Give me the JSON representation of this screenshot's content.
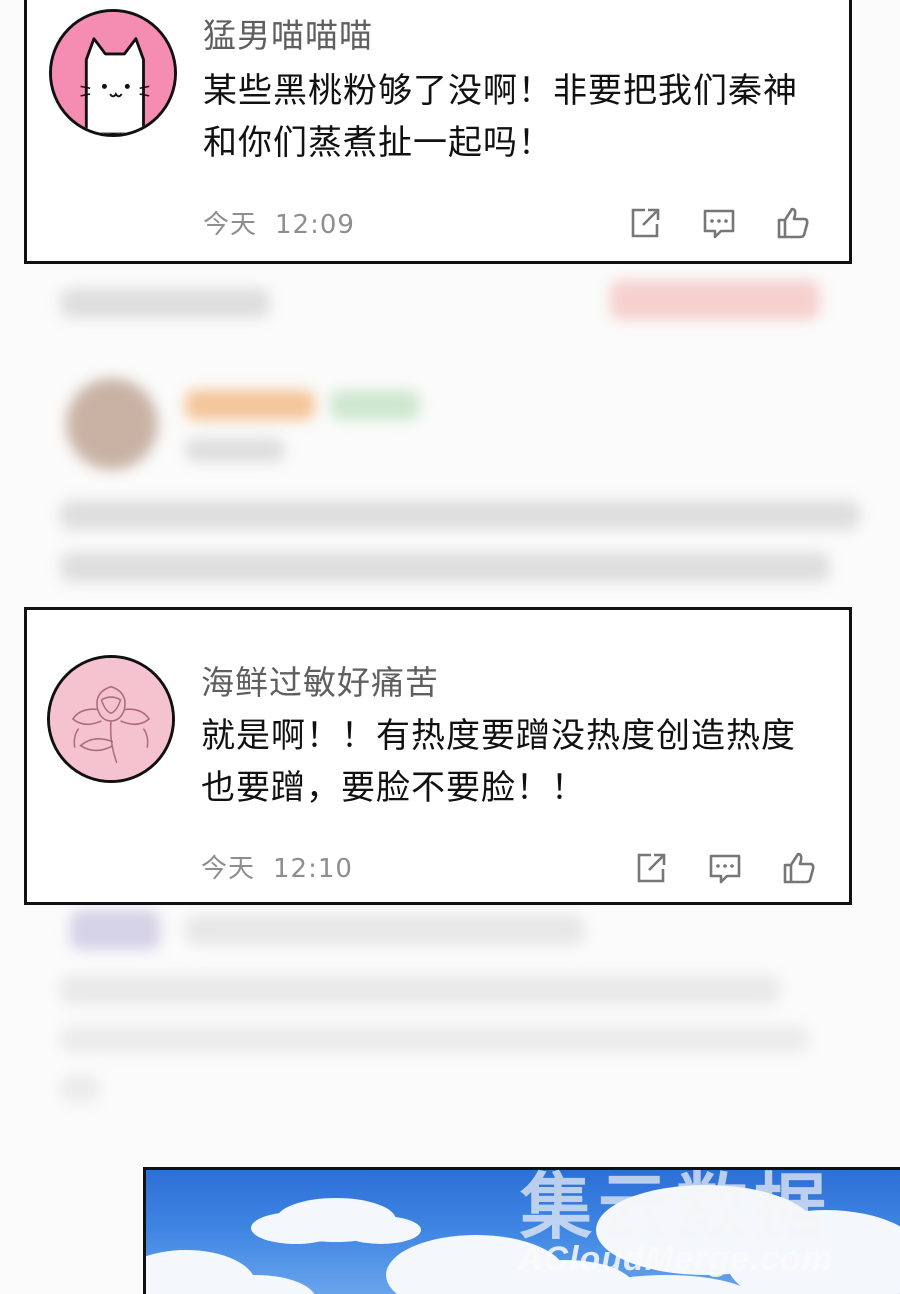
{
  "comments": [
    {
      "username": "猛男喵喵喵",
      "avatar": "white-cat-avatar",
      "text": "某些黑桃粉够了没啊！非要把我们秦神和你们蒸煮扯一起吗！",
      "date": "今天",
      "time": "12:09"
    },
    {
      "username": "海鲜过敏好痛苦",
      "avatar": "pink-rose-avatar",
      "text": "就是啊！！有热度要蹭没热度创造热度也要蹭，要脸不要脸！！",
      "date": "今天",
      "time": "12:10"
    }
  ],
  "actions": [
    "share-icon",
    "reply-icon",
    "like-icon"
  ],
  "watermark": {
    "main": "集云数据",
    "sub": "ACloudMerge.com"
  },
  "colors": {
    "cat_avatar_bg": "#f58cb2",
    "rose_avatar_bg": "#f5c3cf",
    "username": "#5f5f5f",
    "meta": "#8e8e8e",
    "sky": "#3f86e3"
  }
}
